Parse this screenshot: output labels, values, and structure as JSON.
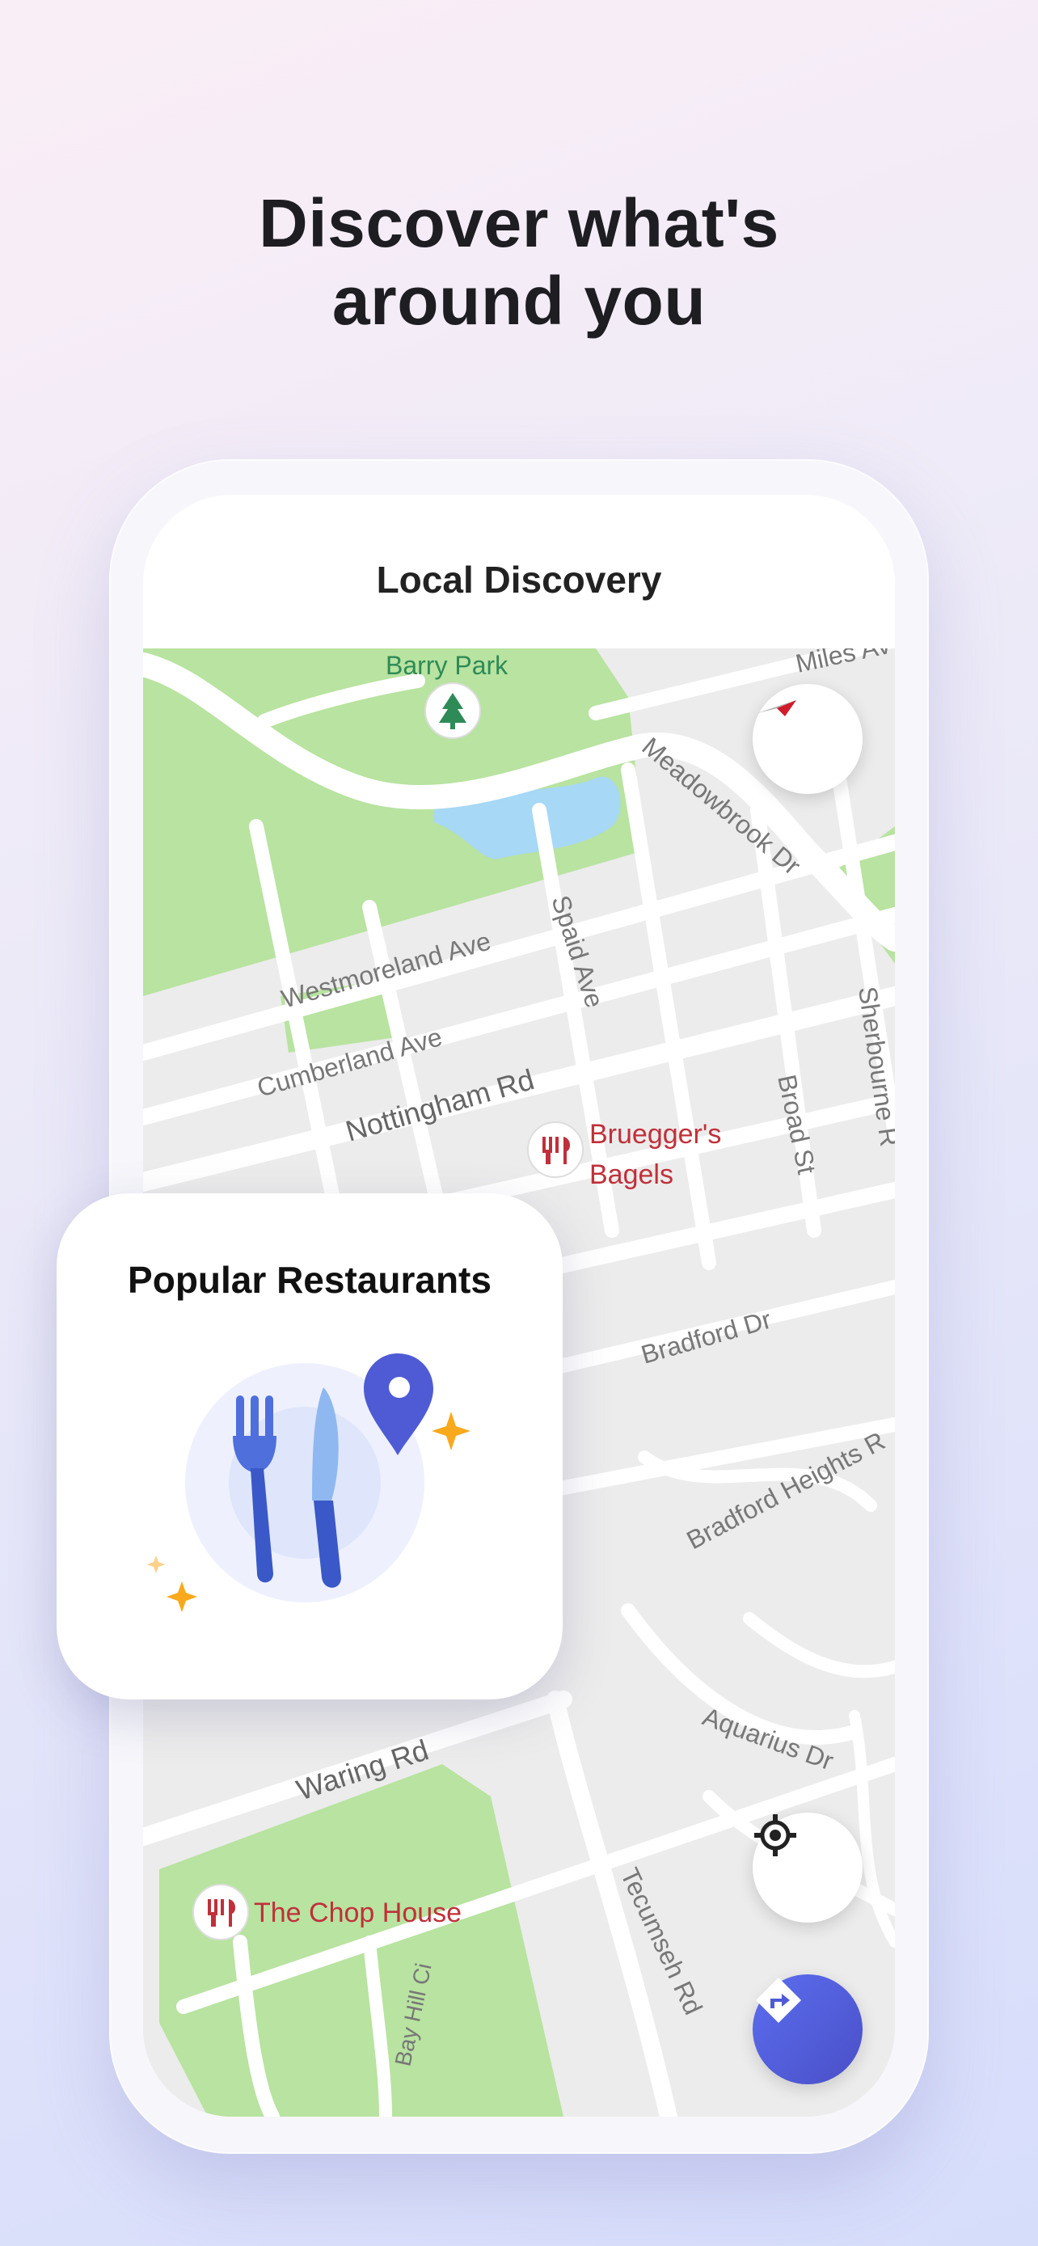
{
  "headline": {
    "line1": "Discover what's",
    "line2": "around you"
  },
  "app": {
    "title": "Local Discovery"
  },
  "map": {
    "parks": [
      "Barry Park"
    ],
    "streets": [
      "Miles Av",
      "Meadowbrook Dr",
      "Westmoreland Ave",
      "Spaid Ave",
      "Cumberland Ave",
      "Nottingham Rd",
      "Broad St",
      "Sherbourne R",
      "Bradford Dr",
      "Bradford Heights R",
      "Aquarius Dr",
      "Waring Rd",
      "Tecumseh Rd",
      "Bay Hill Ci"
    ],
    "restaurants": [
      {
        "line1": "Bruegger's",
        "line2": "Bagels",
        "icon": "fork-knife-icon"
      },
      {
        "line1": "The Chop House",
        "line2": "",
        "icon": "fork-knife-icon"
      }
    ]
  },
  "card": {
    "title": "Popular Restaurants",
    "icon": "restaurant-illustration"
  },
  "controls": {
    "compass": "compass-icon",
    "locate": "locate-icon",
    "directions": "directions-icon"
  },
  "colors": {
    "accent": "#4f5bd5",
    "park": "#b5e09a",
    "water": "#a7d8f5",
    "poi": "#c0303a"
  }
}
